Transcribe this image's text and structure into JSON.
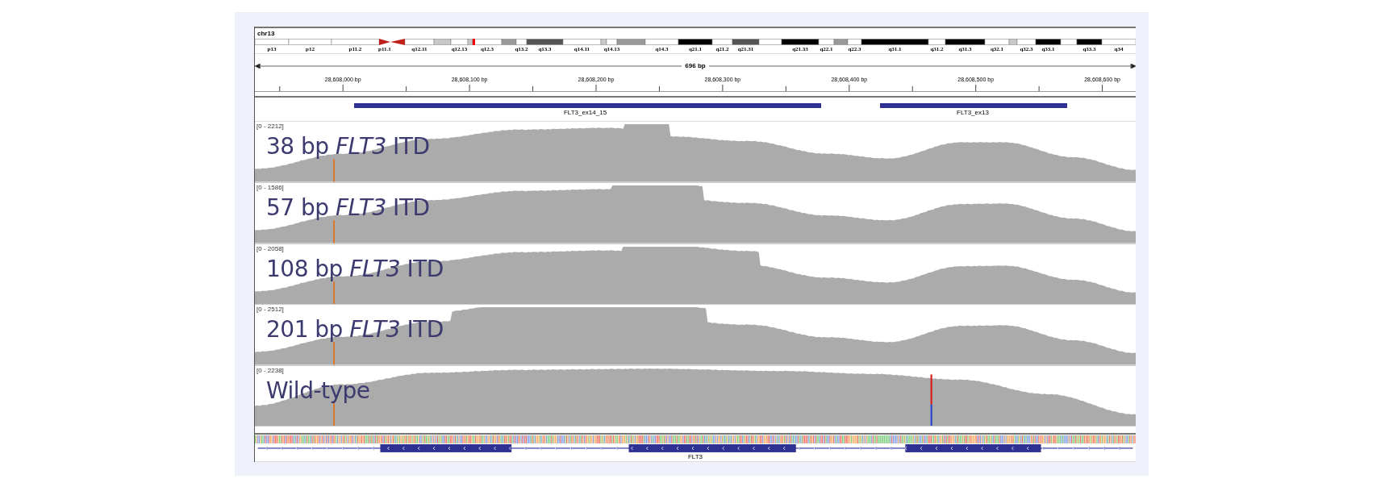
{
  "chromosome": "chr13",
  "bands": [
    {
      "label": "p13",
      "kind": "gneg"
    },
    {
      "label": "p12",
      "kind": "gneg"
    },
    {
      "label": "p11.2",
      "kind": "gneg"
    },
    {
      "label": "p11.1",
      "kind": "acenp"
    },
    {
      "kind": "acenq"
    },
    {
      "label": "q12.11",
      "kind": "gneg"
    },
    {
      "kind": "gpos25"
    },
    {
      "label": "q12.13",
      "kind": "gneg"
    },
    {
      "kind": "gpos25"
    },
    {
      "label": "q12.3",
      "kind": "gneg"
    },
    {
      "kind": "gpos50"
    },
    {
      "label": "q13.2",
      "kind": "gneg"
    },
    {
      "label": "q13.3",
      "kind": "gpos75"
    },
    {
      "label": "q14.11",
      "kind": "gneg"
    },
    {
      "kind": "gpos25"
    },
    {
      "label": "q14.13",
      "kind": "gneg"
    },
    {
      "kind": "gpos50"
    },
    {
      "label": "q14.3",
      "kind": "gneg"
    },
    {
      "label": "q21.1",
      "kind": "gpos100"
    },
    {
      "label": "q21.2",
      "kind": "gneg"
    },
    {
      "label": "q21.31",
      "kind": "gpos75"
    },
    {
      "kind": "gneg"
    },
    {
      "label": "q21.33",
      "kind": "gpos100"
    },
    {
      "label": "q22.1",
      "kind": "gneg"
    },
    {
      "kind": "gpos50"
    },
    {
      "label": "q22.3",
      "kind": "gneg"
    },
    {
      "label": "q31.1",
      "kind": "gpos100"
    },
    {
      "label": "q31.2",
      "kind": "gneg"
    },
    {
      "label": "q31.3",
      "kind": "gpos100"
    },
    {
      "label": "q32.1",
      "kind": "gneg"
    },
    {
      "kind": "gpos25"
    },
    {
      "label": "q32.3",
      "kind": "gneg"
    },
    {
      "label": "q33.1",
      "kind": "gpos100"
    },
    {
      "kind": "gneg"
    },
    {
      "label": "q33.3",
      "kind": "gpos100"
    },
    {
      "label": "q34",
      "kind": "gneg"
    }
  ],
  "ruler": {
    "span": "696 bp",
    "ticks": [
      "28,608,000 bp",
      "28,608,100 bp",
      "28,608,200 bp",
      "28,608,300 bp",
      "28,608,400 bp",
      "28,608,500 bp",
      "28,608,600 bp"
    ]
  },
  "features": [
    {
      "label": "FLT3_ex14_15"
    },
    {
      "label": "FLT3_ex13"
    }
  ],
  "tracks": [
    {
      "kind": "itd",
      "range": "[0 - 2212]",
      "label": "38 bp *FLT3* ITD"
    },
    {
      "kind": "itd",
      "range": "[0 - 1586]",
      "label": "57 bp *FLT3* ITD"
    },
    {
      "kind": "itd",
      "range": "[0 - 2058]",
      "label": "108 bp *FLT3* ITD"
    },
    {
      "kind": "itd",
      "range": "[0 - 2512]",
      "label": "201 bp *FLT3* ITD"
    },
    {
      "kind": "wild_type",
      "range": "[0 - 2238]",
      "label": "Wild-type"
    }
  ],
  "gene": {
    "label": "FLT3"
  }
}
